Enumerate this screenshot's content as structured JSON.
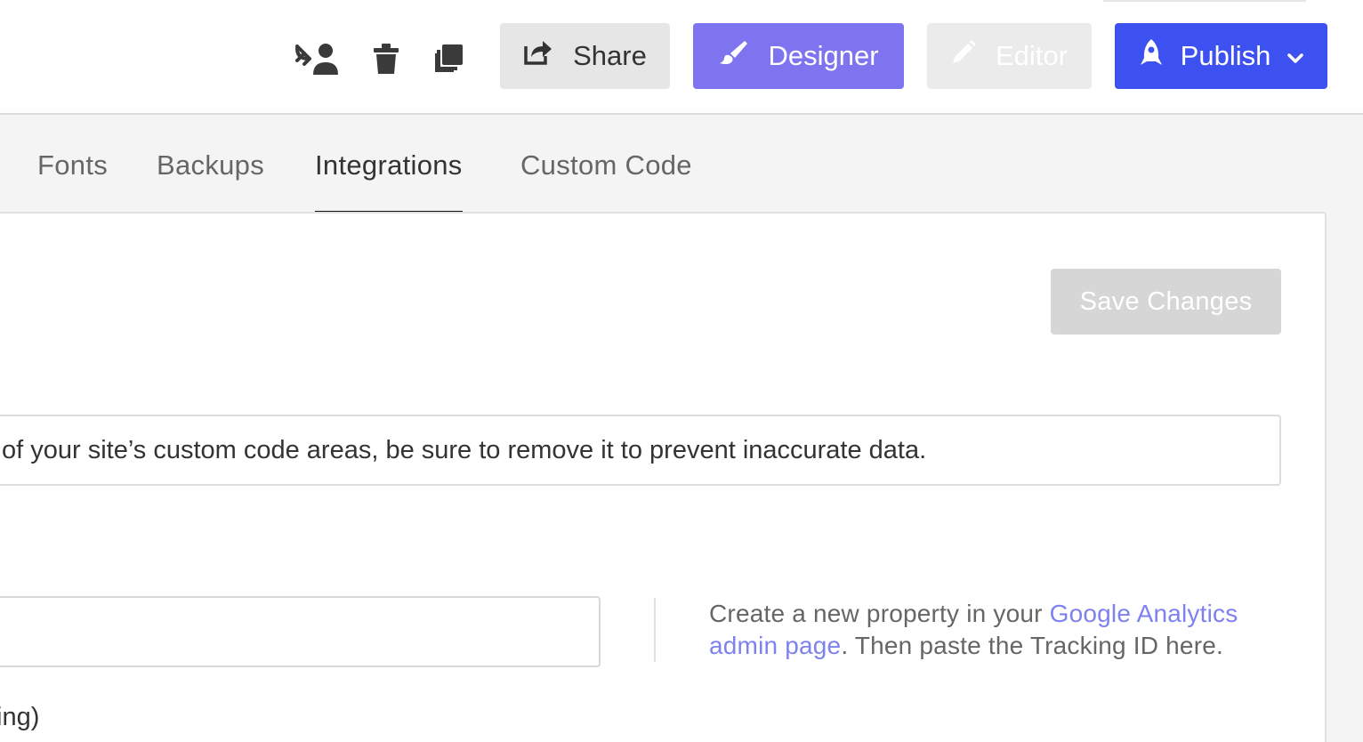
{
  "toolbar": {
    "icons": [
      "transfer-user-icon",
      "trash-icon",
      "duplicate-icon"
    ],
    "share_label": "Share",
    "designer_label": "Designer",
    "editor_label": "Editor",
    "publish_label": "Publish"
  },
  "colors": {
    "designer": "#7e74ef",
    "publish": "#3d51f0",
    "link": "#7d82f0"
  },
  "tabs": [
    {
      "label": "Fonts",
      "active": false
    },
    {
      "label": "Backups",
      "active": false
    },
    {
      "label": "Integrations",
      "active": true
    },
    {
      "label": "Custom Code",
      "active": false
    }
  ],
  "panel": {
    "save_label": "Save Changes",
    "notice": "of your site’s custom code areas, be sure to remove it to prevent inaccurate data.",
    "tracking_input_value": "",
    "help_text_before": "Create a new property in your ",
    "help_link": "Google Analytics admin page",
    "help_text_after": ". Then paste the Tracking ID here.",
    "cut_label": "ing)"
  }
}
